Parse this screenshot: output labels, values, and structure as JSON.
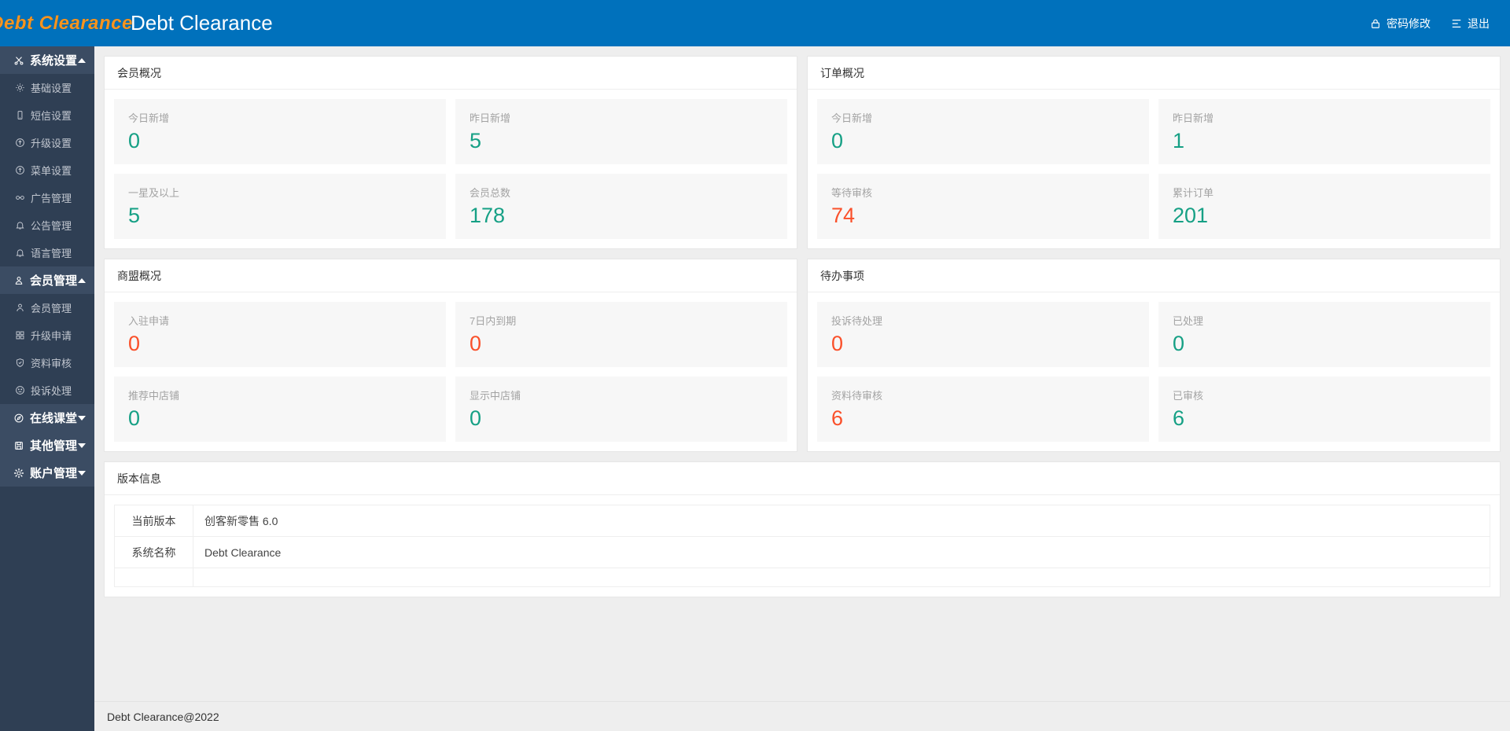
{
  "header": {
    "brand_name": "Debt Clearance",
    "title": "Debt Clearance",
    "logo_icon": "cube-logo-icon",
    "links": [
      {
        "label": "密码修改",
        "icon": "lock-icon"
      },
      {
        "label": "退出",
        "icon": "logout-icon"
      }
    ]
  },
  "sidebar": {
    "groups": [
      {
        "label": "系统设置",
        "icon": "scissors-icon",
        "expanded": true,
        "caret": "up",
        "items": [
          {
            "label": "基础设置",
            "icon": "gear-icon"
          },
          {
            "label": "短信设置",
            "icon": "mobile-icon"
          },
          {
            "label": "升级设置",
            "icon": "arrow-up-circle-icon"
          },
          {
            "label": "菜单设置",
            "icon": "arrow-up-circle-icon"
          },
          {
            "label": "广告管理",
            "icon": "glasses-icon"
          },
          {
            "label": "公告管理",
            "icon": "bell-icon"
          },
          {
            "label": "语言管理",
            "icon": "bell-icon"
          }
        ]
      },
      {
        "label": "会员管理",
        "icon": "user-badge-icon",
        "expanded": true,
        "caret": "up",
        "items": [
          {
            "label": "会员管理",
            "icon": "user-icon"
          },
          {
            "label": "升级申请",
            "icon": "grid-icon"
          },
          {
            "label": "资料审核",
            "icon": "shield-check-icon"
          },
          {
            "label": "投诉处理",
            "icon": "sad-face-icon"
          }
        ]
      },
      {
        "label": "在线课堂",
        "icon": "compass-icon",
        "expanded": false,
        "caret": "down",
        "items": []
      },
      {
        "label": "其他管理",
        "icon": "save-icon",
        "expanded": false,
        "caret": "down",
        "items": []
      },
      {
        "label": "账户管理",
        "icon": "gear-icon",
        "expanded": false,
        "caret": "down",
        "items": []
      }
    ]
  },
  "cards": {
    "member_overview": {
      "title": "会员概况",
      "stats": [
        {
          "label": "今日新增",
          "value": "0",
          "color": "teal"
        },
        {
          "label": "昨日新增",
          "value": "5",
          "color": "teal"
        },
        {
          "label": "一星及以上",
          "value": "5",
          "color": "teal"
        },
        {
          "label": "会员总数",
          "value": "178",
          "color": "teal"
        }
      ]
    },
    "order_overview": {
      "title": "订单概况",
      "stats": [
        {
          "label": "今日新增",
          "value": "0",
          "color": "teal"
        },
        {
          "label": "昨日新增",
          "value": "1",
          "color": "teal"
        },
        {
          "label": "等待审核",
          "value": "74",
          "color": "orange"
        },
        {
          "label": "累计订单",
          "value": "201",
          "color": "teal"
        }
      ]
    },
    "merchant_overview": {
      "title": "商盟概况",
      "stats": [
        {
          "label": "入驻申请",
          "value": "0",
          "color": "orange"
        },
        {
          "label": "7日内到期",
          "value": "0",
          "color": "orange"
        },
        {
          "label": "推荐中店铺",
          "value": "0",
          "color": "teal"
        },
        {
          "label": "显示中店铺",
          "value": "0",
          "color": "teal"
        }
      ]
    },
    "todo": {
      "title": "待办事项",
      "stats": [
        {
          "label": "投诉待处理",
          "value": "0",
          "color": "orange"
        },
        {
          "label": "已处理",
          "value": "0",
          "color": "teal"
        },
        {
          "label": "资料待审核",
          "value": "6",
          "color": "orange"
        },
        {
          "label": "已审核",
          "value": "6",
          "color": "teal"
        }
      ]
    },
    "version": {
      "title": "版本信息",
      "rows": [
        {
          "key": "当前版本",
          "value": "创客新零售 6.0"
        },
        {
          "key": "系统名称",
          "value": "Debt Clearance"
        }
      ]
    }
  },
  "footer": {
    "text": "Debt Clearance@2022"
  },
  "colors": {
    "header_blue": "#0071bc",
    "sidebar_dark": "#2f3f54",
    "sidebar_active": "#3b4c63",
    "brand_orange": "#f7941e",
    "value_teal": "#16a085",
    "value_orange": "#fa502a"
  }
}
